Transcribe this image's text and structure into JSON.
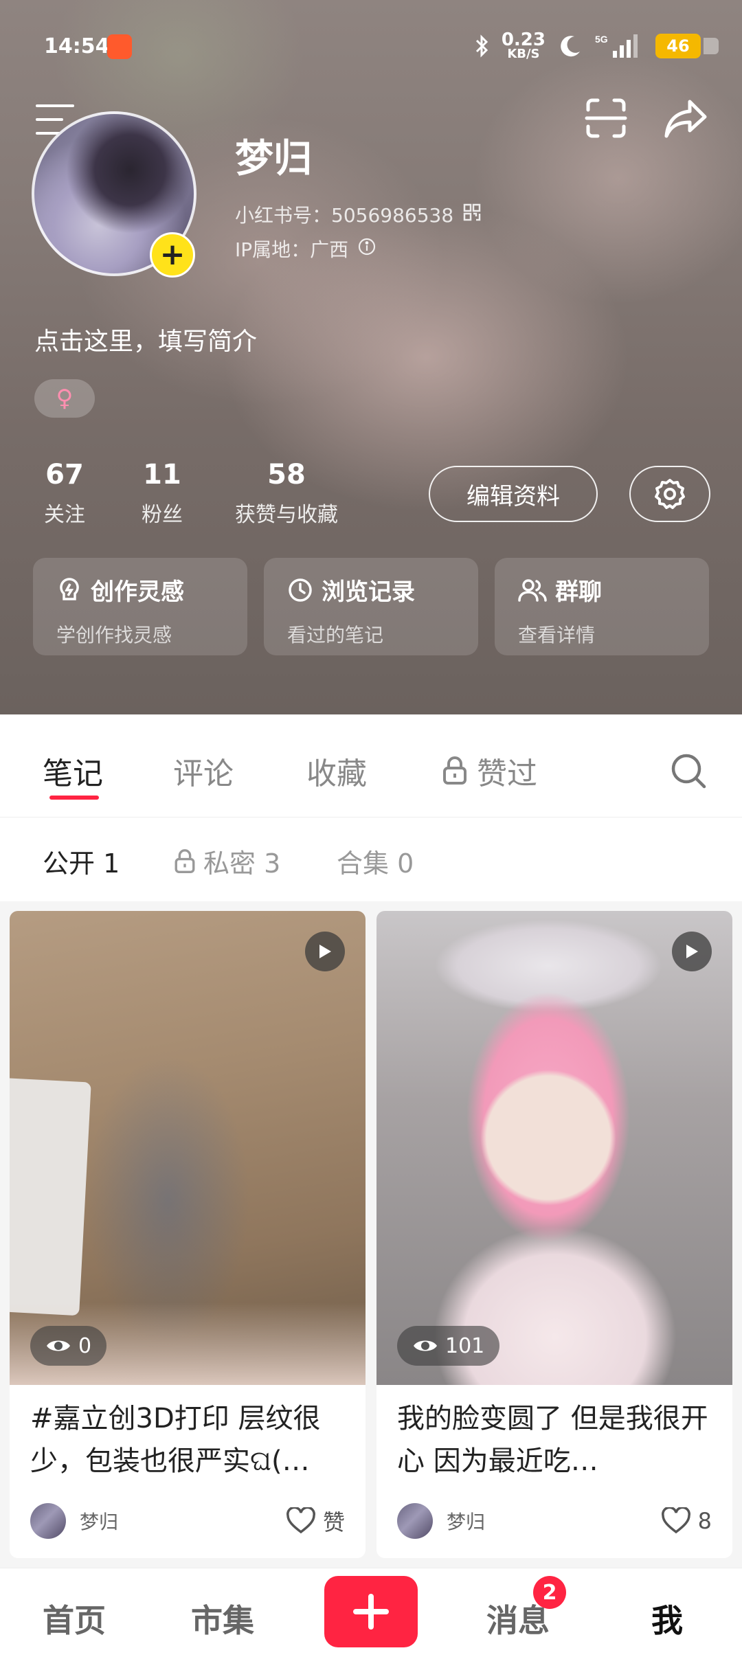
{
  "status_bar": {
    "time": "14:54",
    "net_speed_value": "0.23",
    "net_speed_unit": "KB/S",
    "network": "5G",
    "battery": "46",
    "icons": [
      "app-notification-icon",
      "bluetooth-icon",
      "moon-icon",
      "signal-icon"
    ]
  },
  "profile": {
    "nickname": "梦归",
    "redbook_id": "小红书号：5056986538",
    "ip_location": "IP属地：广西",
    "bio_placeholder": "点击这里，填写简介",
    "gender_symbol": "♀",
    "gender_color": "#ff8fb0"
  },
  "stats": [
    {
      "value": "67",
      "label": "关注"
    },
    {
      "value": "11",
      "label": "粉丝"
    },
    {
      "value": "58",
      "label": "获赞与收藏"
    }
  ],
  "actions": {
    "edit_profile": "编辑资料"
  },
  "cards": [
    {
      "title": "创作灵感",
      "subtitle": "学创作找灵感",
      "icon": "lightbulb-icon"
    },
    {
      "title": "浏览记录",
      "subtitle": "看过的笔记",
      "icon": "clock-icon"
    },
    {
      "title": "群聊",
      "subtitle": "查看详情",
      "icon": "group-icon"
    }
  ],
  "main_tabs": [
    {
      "label": "笔记",
      "active": true
    },
    {
      "label": "评论",
      "active": false
    },
    {
      "label": "收藏",
      "active": false
    },
    {
      "label": "赞过",
      "active": false,
      "locked": true
    }
  ],
  "sub_tabs": [
    {
      "label": "公开 1",
      "active": true
    },
    {
      "label": "私密 3",
      "active": false,
      "locked": true
    },
    {
      "label": "合集 0",
      "active": false
    }
  ],
  "notes": [
    {
      "title": "#嘉立创3D打印 层纹很少，包装也很严实ଘ(…",
      "views": "0",
      "author": "梦归",
      "likes": "赞",
      "is_video": true
    },
    {
      "title": "我的脸变圆了 但是我很开心 因为最近吃…",
      "views": "101",
      "author": "梦归",
      "likes": "8",
      "is_video": true
    }
  ],
  "bottom_nav": {
    "items": [
      "首页",
      "市集",
      "消息",
      "我"
    ],
    "active": "我",
    "message_badge": "2"
  },
  "colors": {
    "accent": "#ff2442",
    "avatar_add": "#ffe21a",
    "battery": "#f5b800"
  }
}
